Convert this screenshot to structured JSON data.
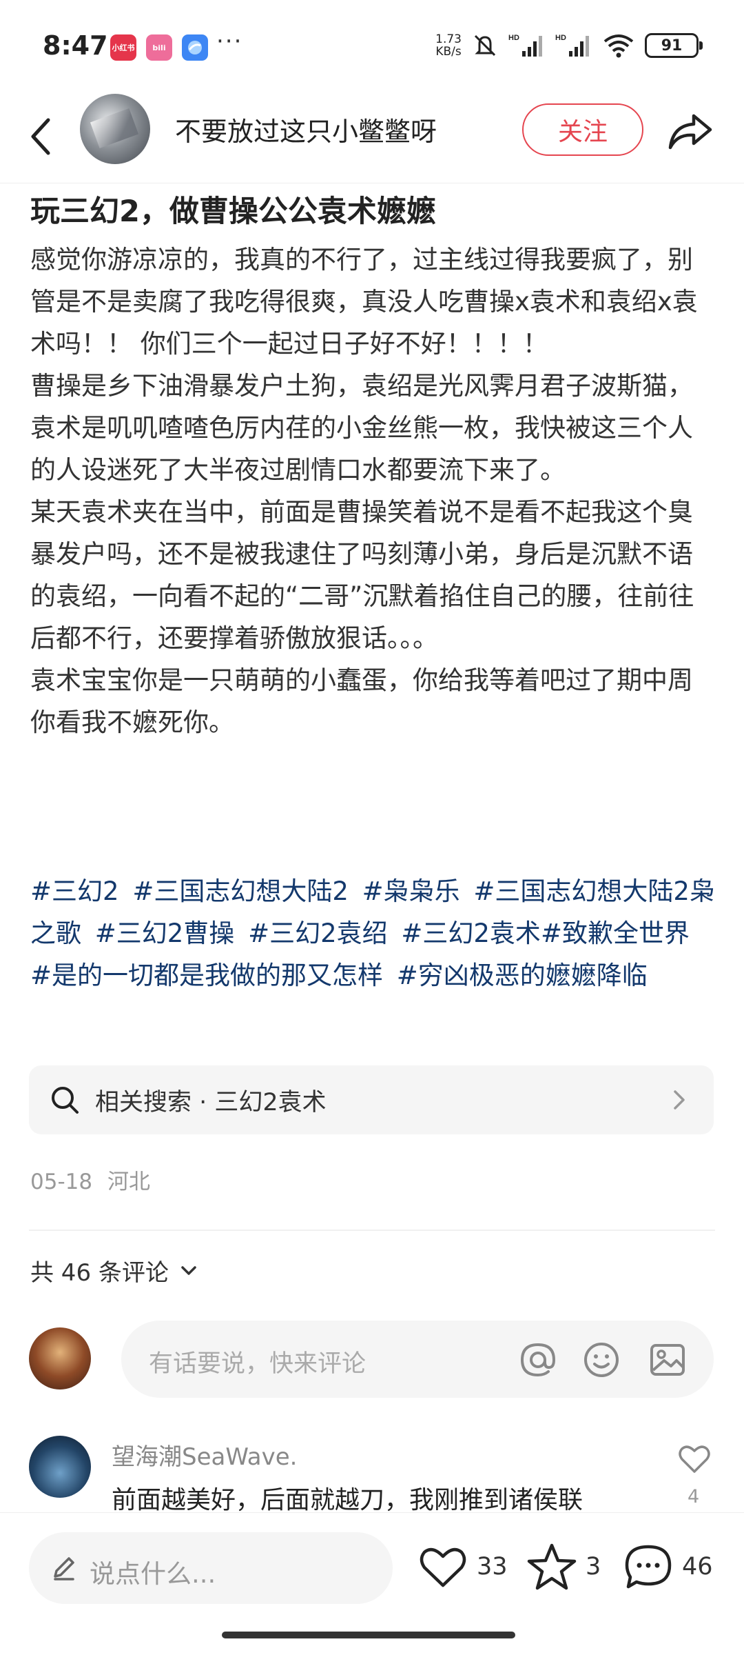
{
  "status_bar": {
    "time": "8:47",
    "apps": [
      {
        "name": "xiaohongshu-icon",
        "label": "小红书",
        "color": "#e5354b"
      },
      {
        "name": "bilibili-icon",
        "label": "bili",
        "color": "#ee6d9a"
      },
      {
        "name": "browser-icon",
        "label": "",
        "color": "#3d86f4"
      }
    ],
    "more": "···",
    "speed_value": "1.73",
    "speed_unit": "KB/s",
    "battery": "91"
  },
  "header": {
    "author_name": "不要放过这只小鳖鳖呀",
    "follow_label": "关注"
  },
  "post": {
    "title": "玩三幻2，做曹操公公袁术嬷嬷",
    "paragraphs": [
      "感觉你游凉凉的，我真的不行了，过主线过得我要疯了，别管是不是卖腐了我吃得很爽，真没人吃曹操x袁术和袁绍x袁术吗！！ 你们三个一起过日子好不好！！！！",
      "曹操是乡下油滑暴发户土狗，袁绍是光风霁月君子波斯猫，袁术是叽叽喳喳色厉内荏的小金丝熊一枚，我快被这三个人的人设迷死了大半夜过剧情口水都要流下来了。",
      "某天袁术夹在当中，前面是曹操笑着说不是看不起我这个臭暴发户吗，还不是被我逮住了吗刻薄小弟，身后是沉默不语的袁绍，一向看不起的“二哥”沉默着掐住自己的腰，往前往后都不行，还要撑着骄傲放狠话。。。",
      "袁术宝宝你是一只萌萌的小蠢蛋，你给我等着吧过了期中周你看我不嬷死你。"
    ],
    "tags": [
      "#三幻2",
      "#三国志幻想大陆2",
      "#枭枭乐",
      "#三国志幻想大陆2枭之歌",
      "#三幻2曹操",
      "#三幻2袁绍",
      "#三幻2袁术",
      "#致歉全世界",
      "#是的一切都是我做的那又怎样",
      "#穷凶极恶的嬷嬷降临"
    ],
    "related_search": "相关搜索 · 三幻2袁术",
    "date": "05-18",
    "location": "河北"
  },
  "comments": {
    "count_label": "共 46 条评论",
    "input_placeholder": "有话要说，快来评论",
    "items": [
      {
        "user": "望海潮SeaWave.",
        "text": "前面越美好，后面就越刀，我刚推到诸侯联",
        "likes": "4"
      }
    ]
  },
  "bottom_bar": {
    "input_placeholder": "说点什么...",
    "likes": "33",
    "favorites": "3",
    "comments": "46"
  }
}
